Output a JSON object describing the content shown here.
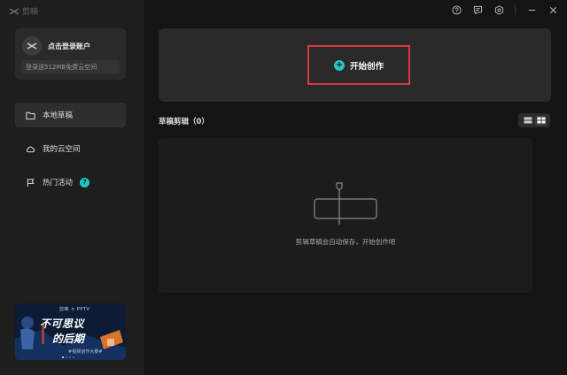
{
  "app": {
    "logo_text": "剪映",
    "window_controls": [
      "help-icon",
      "feedback-icon",
      "settings-icon",
      "minimize-icon",
      "close-icon"
    ]
  },
  "sidebar": {
    "login_label": "点击登录账户",
    "promo_text": "登录送512MB免费云空间",
    "items": [
      {
        "label": "本地草稿",
        "icon": "folder-icon",
        "active": true
      },
      {
        "label": "我的云空间",
        "icon": "cloud-icon",
        "active": false
      },
      {
        "label": "热门活动",
        "icon": "flag-icon",
        "active": false,
        "badge": "7"
      }
    ],
    "banner": {
      "brand": "剪映 × PPTV",
      "title_line1": "不可思议",
      "title_line2": "的后期",
      "subtitle": "#视频创作大赛#"
    }
  },
  "main": {
    "create_label": "开始创作",
    "drafts_title": "草稿剪辑（0）",
    "empty_text": "剪辑草稿会自动保存，开始创作吧"
  },
  "colors": {
    "accent": "#2cc3c3",
    "highlight_box": "#d83a3a",
    "background": "#141414",
    "panel": "#2a2a2a"
  }
}
